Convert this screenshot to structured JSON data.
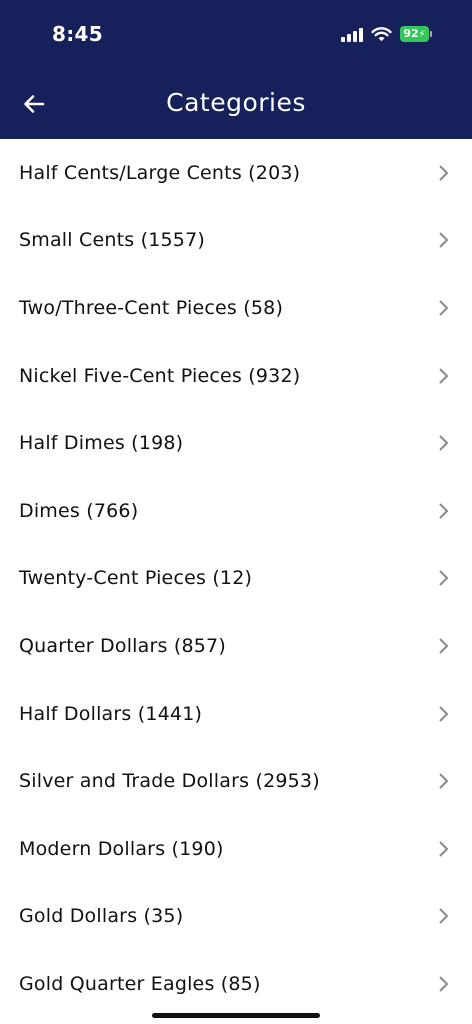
{
  "status_bar": {
    "time": "8:45",
    "battery": "92"
  },
  "header": {
    "title": "Categories",
    "back_icon": "arrow-left-icon"
  },
  "colors": {
    "header_bg": "#16205a",
    "battery_green": "#34c759",
    "chevron": "#8a8a8a"
  },
  "categories": [
    {
      "label": "Half Cents/Large Cents (203)"
    },
    {
      "label": "Small Cents (1557)"
    },
    {
      "label": "Two/Three-Cent Pieces (58)"
    },
    {
      "label": "Nickel Five-Cent Pieces (932)"
    },
    {
      "label": "Half Dimes (198)"
    },
    {
      "label": "Dimes (766)"
    },
    {
      "label": "Twenty-Cent Pieces (12)"
    },
    {
      "label": "Quarter Dollars (857)"
    },
    {
      "label": "Half Dollars (1441)"
    },
    {
      "label": "Silver and Trade Dollars (2953)"
    },
    {
      "label": "Modern Dollars (190)"
    },
    {
      "label": "Gold Dollars (35)"
    },
    {
      "label": "Gold Quarter Eagles (85)"
    }
  ]
}
